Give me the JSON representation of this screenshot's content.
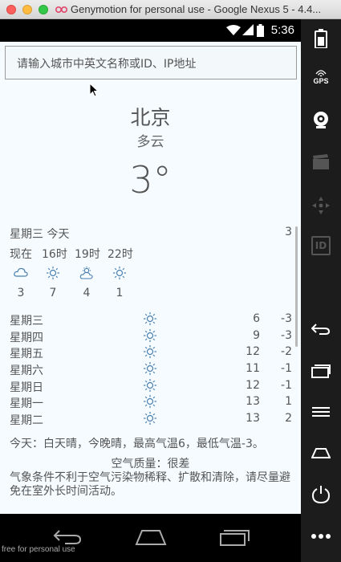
{
  "window": {
    "title": "Genymotion for personal use - Google Nexus 5 - 4.4..."
  },
  "statusbar": {
    "time": "5:36"
  },
  "search": {
    "placeholder": "请输入城市中英文名称或ID、IP地址"
  },
  "current": {
    "city": "北京",
    "weather": "多云",
    "temperature": "3°"
  },
  "today_row": {
    "label": "星期三  今天",
    "value": "3"
  },
  "hourly": [
    {
      "label": "现在",
      "icon": "cloudy-icon",
      "temp": "3"
    },
    {
      "label": "16时",
      "icon": "sun-icon",
      "temp": "7"
    },
    {
      "label": "19时",
      "icon": "partly-cloudy-icon",
      "temp": "4"
    },
    {
      "label": "22时",
      "icon": "sun-icon",
      "temp": "1"
    }
  ],
  "forecast": [
    {
      "day": "星期三",
      "icon": "sun-icon",
      "high": "6",
      "low": "-3"
    },
    {
      "day": "星期四",
      "icon": "sun-icon",
      "high": "9",
      "low": "-3"
    },
    {
      "day": "星期五",
      "icon": "sun-icon",
      "high": "12",
      "low": "-2"
    },
    {
      "day": "星期六",
      "icon": "sun-icon",
      "high": "11",
      "low": "-1"
    },
    {
      "day": "星期日",
      "icon": "sun-icon",
      "high": "12",
      "low": "-1"
    },
    {
      "day": "星期一",
      "icon": "sun-icon",
      "high": "13",
      "low": "1"
    },
    {
      "day": "星期二",
      "icon": "sun-icon",
      "high": "13",
      "low": "2"
    }
  ],
  "summary": {
    "today": "今天：白天晴，今晚晴，最高气温6，最低气温-3。",
    "aqi": "空气质量：很差",
    "advice": "气象条件不利于空气污染物稀释、扩散和清除，请尽量避免在室外长时间活动。"
  },
  "sidepanel": {
    "gps_label": "GPS",
    "id_label": "ID"
  },
  "watermark": "free for personal use",
  "colors": {
    "app_bg": "#f5fbff",
    "text": "#555555",
    "icon_blue": "#4a7fb0"
  }
}
